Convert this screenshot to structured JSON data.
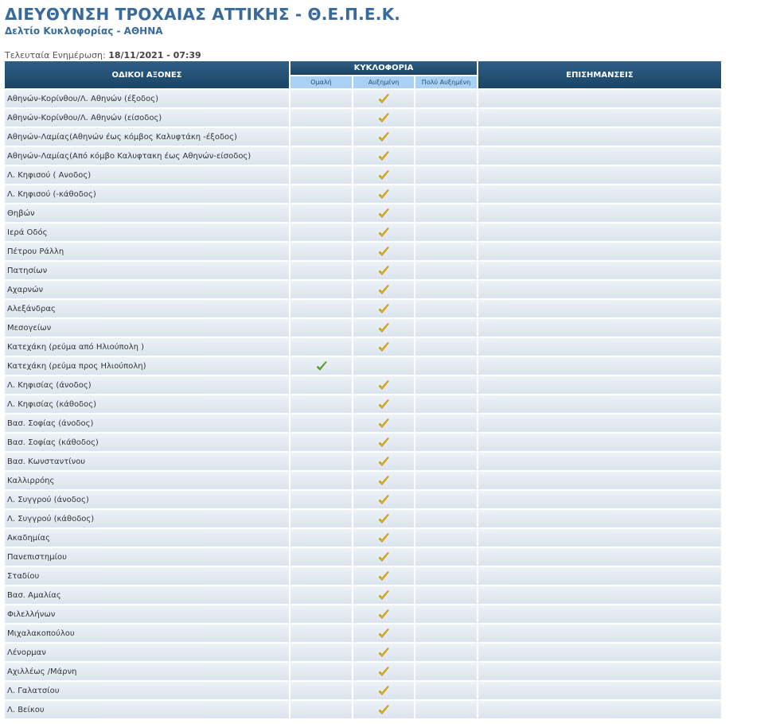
{
  "page": {
    "title": "ΔΙΕΥΘΥΝΣΗ ΤΡΟΧΑΙΑΣ ΑΤΤΙΚΗΣ - Θ.Ε.Π.Ε.Κ.",
    "subtitle": "Δελτίο Κυκλοφορίας - ΑΘΗΝΑ",
    "update_label": "Τελευταία Ενημέρωση:",
    "update_value": "18/11/2021 - 07:39"
  },
  "table": {
    "headers": {
      "roads": "ΟΔΙΚΟΙ ΑΞΟΝΕΣ",
      "traffic": "ΚΥΚΛΟΦΟΡΙΑ",
      "notes": "ΕΠΙΣΗΜΑΝΣΕΙΣ"
    },
    "levels": [
      "Ομαλή",
      "Αυξημένη",
      "Πολύ Αυξημένη"
    ],
    "mark_colors": {
      "normal": "#3cb43c",
      "increased": "#f0b400"
    },
    "rows": [
      {
        "road": "Αθηνών-Κορίνθου/Λ. Αθηνών (έξοδος)",
        "level": 1
      },
      {
        "road": "Αθηνών-Κορίνθου/Λ. Αθηνών (είσοδος)",
        "level": 1
      },
      {
        "road": "Αθηνών-Λαμίας(Αθηνών έως κόμβος Καλυφτάκη -έξοδος)",
        "level": 1
      },
      {
        "road": "Αθηνών-Λαμίας(Από κόμβο Καλυφτακη έως Αθηνών-είσοδος)",
        "level": 1
      },
      {
        "road": "Λ. Κηφισού ( Ανοδος)",
        "level": 1
      },
      {
        "road": "Λ. Κηφισού (-κάθοδος)",
        "level": 1
      },
      {
        "road": "Θηβών",
        "level": 1
      },
      {
        "road": "Ιερά Οδός",
        "level": 1
      },
      {
        "road": "Πέτρου Ράλλη",
        "level": 1
      },
      {
        "road": "Πατησίων",
        "level": 1
      },
      {
        "road": "Αχαρνών",
        "level": 1
      },
      {
        "road": "Αλεξάνδρας",
        "level": 1
      },
      {
        "road": "Μεσογείων",
        "level": 1
      },
      {
        "road": "Κατεχάκη (ρεύμα από Ηλιούπολη )",
        "level": 1
      },
      {
        "road": "Κατεχάκη (ρεύμα προς Ηλιούπολη)",
        "level": 0
      },
      {
        "road": "Λ. Κηφισίας (άνοδος)",
        "level": 1
      },
      {
        "road": "Λ. Κηφισίας (κάθοδος)",
        "level": 1
      },
      {
        "road": "Βασ. Σοφίας (άνοδος)",
        "level": 1
      },
      {
        "road": "Βασ. Σοφίας (κάθοδος)",
        "level": 1
      },
      {
        "road": "Βασ. Κωνσταντίνου",
        "level": 1
      },
      {
        "road": "Καλλιρρόης",
        "level": 1
      },
      {
        "road": "Λ. Συγγρού (άνοδος)",
        "level": 1
      },
      {
        "road": "Λ. Συγγρού (κάθοδος)",
        "level": 1
      },
      {
        "road": "Ακαδημίας",
        "level": 1
      },
      {
        "road": "Πανεπιστημίου",
        "level": 1
      },
      {
        "road": "Σταδίου",
        "level": 1
      },
      {
        "road": "Βασ. Αμαλίας",
        "level": 1
      },
      {
        "road": "Φιλελλήνων",
        "level": 1
      },
      {
        "road": "Μιχαλακοπούλου",
        "level": 1
      },
      {
        "road": "Λένορμαν",
        "level": 1
      },
      {
        "road": "Αχιλλέως /Μάρνη",
        "level": 1
      },
      {
        "road": "Λ. Γαλατσίου",
        "level": 1
      },
      {
        "road": "Λ. Βείκου",
        "level": 1
      }
    ]
  }
}
